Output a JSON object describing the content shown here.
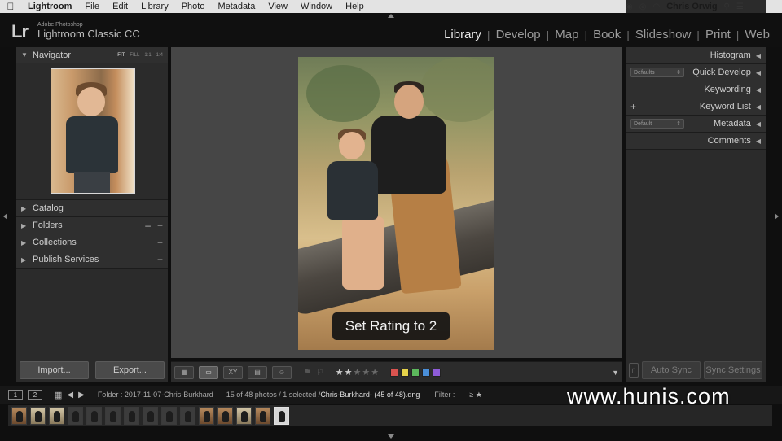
{
  "menubar": {
    "app": "Lightroom",
    "items": [
      "File",
      "Edit",
      "Library",
      "Photo",
      "Metadata",
      "View",
      "Window",
      "Help"
    ],
    "user": "Chris Orwig"
  },
  "brand": {
    "logo": "Lr",
    "line1": "Adobe Photoshop",
    "line2": "Lightroom Classic CC"
  },
  "modules": [
    "Library",
    "Develop",
    "Map",
    "Book",
    "Slideshow",
    "Print",
    "Web"
  ],
  "left_panel": {
    "navigator": {
      "title": "Navigator",
      "options": [
        "FIT",
        "FILL",
        "1:1",
        "1:4"
      ]
    },
    "sections": [
      "Catalog",
      "Folders",
      "Collections",
      "Publish Services"
    ],
    "import_label": "Import...",
    "export_label": "Export..."
  },
  "center": {
    "toast": "Set Rating to 2"
  },
  "toolbar": {
    "rating": 2,
    "label_colors": [
      "#d9534f",
      "#e5d24a",
      "#5cb85c",
      "#4a8fd9",
      "#8e5cd9"
    ]
  },
  "right_panel": {
    "rows": [
      {
        "title": "Histogram"
      },
      {
        "title": "Quick Develop",
        "dropdown": "Defaults"
      },
      {
        "title": "Keywording"
      },
      {
        "title": "Keyword List",
        "plus": "+"
      },
      {
        "title": "Metadata",
        "dropdown": "Default"
      },
      {
        "title": "Comments"
      }
    ],
    "auto_sync_label": "Auto Sync",
    "sync_settings_label": "Sync Settings"
  },
  "filmstrip": {
    "screen1": "1",
    "screen2": "2",
    "folder_text": "Folder : 2017-11-07-Chris-Burkhard",
    "count_text": "15 of 48 photos / 1 selected /",
    "file_text": "Chris-Burkhard- (45 of 48).dng",
    "filter_label": "Filter :",
    "rating_filter": "≥ ★"
  },
  "watermark": "www.hunis.com"
}
